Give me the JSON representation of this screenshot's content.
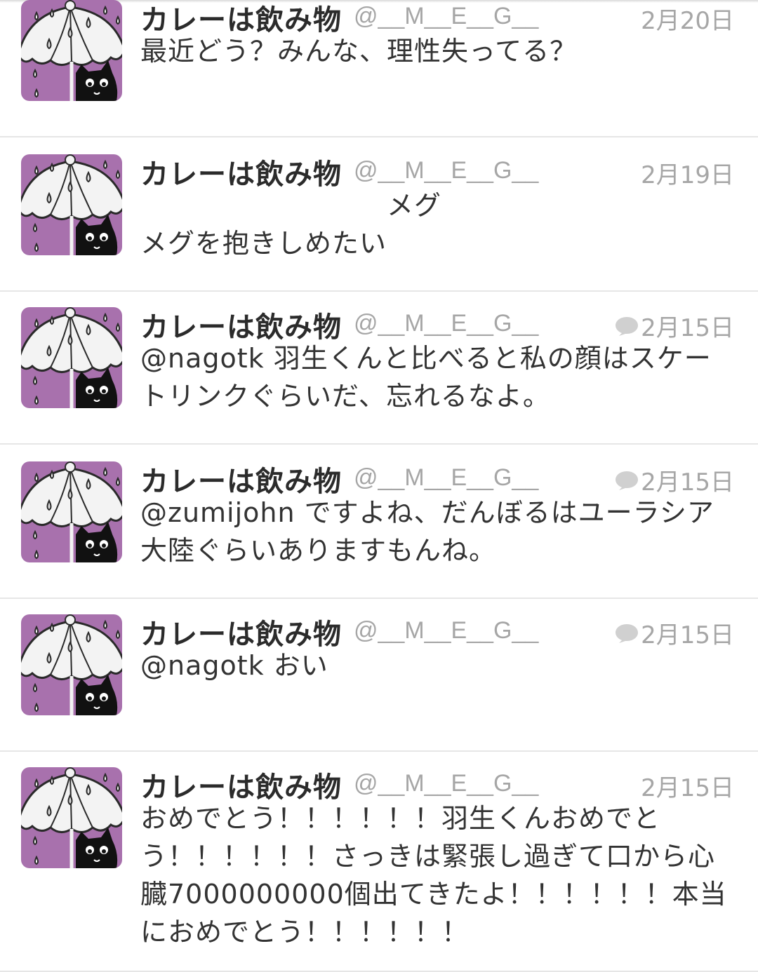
{
  "user": {
    "display_name": "カレーは飲み物",
    "handle": "@__M__E__G__"
  },
  "tweets": [
    {
      "date": "2月20日",
      "text": "最近どう？みんな、理性失ってる？",
      "has_reply_icon": false
    },
    {
      "date": "2月19日",
      "text": "　　　　　　　　　メグ\nメグを抱きしめたい",
      "has_reply_icon": false
    },
    {
      "date": "2月15日",
      "text": "@nagotk 羽生くんと比べると私の顔はスケートリンクぐらいだ、忘れるなよ。",
      "has_reply_icon": true
    },
    {
      "date": "2月15日",
      "text": "@zumijohn ですよね、だんぼるはユーラシア大陸ぐらいありますもんね。",
      "has_reply_icon": true
    },
    {
      "date": "2月15日",
      "text": "@nagotk おい",
      "has_reply_icon": true
    },
    {
      "date": "2月15日",
      "text": "おめでとう！！！！！！羽生くんおめでとう！！！！！！さっきは緊張し過ぎて口から心臓7000000000個出てきたよ！！！！！！本当におめでとう！！！！！！",
      "has_reply_icon": false
    }
  ],
  "colors": {
    "avatar_bg": "#a871ad",
    "umbrella": "#f3f3f3",
    "cat": "#111111",
    "muted_text": "#a6a6a6",
    "divider": "#e6e6e6"
  },
  "icons": {
    "avatar": "umbrella-cat-avatar-icon",
    "reply": "speech-bubble-icon"
  }
}
